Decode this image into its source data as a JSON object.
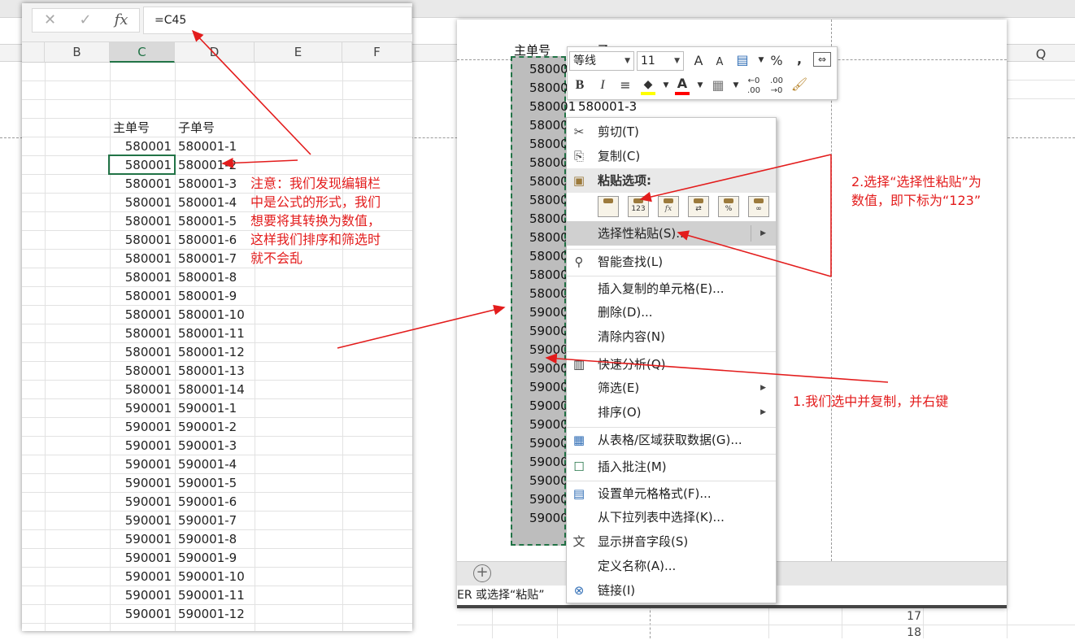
{
  "left": {
    "formula_bar": {
      "cancel_icon": "✕",
      "enter_icon": "✓",
      "fx_label": "fx",
      "formula": "=C45"
    },
    "columns": [
      "B",
      "C",
      "D",
      "E",
      "F"
    ],
    "header_row": {
      "main": "主单号",
      "sub": "子单号"
    },
    "rows": [
      {
        "main": "580001",
        "sub": "580001-1"
      },
      {
        "main": "580001",
        "sub": "580001-2"
      },
      {
        "main": "580001",
        "sub": "580001-3"
      },
      {
        "main": "580001",
        "sub": "580001-4"
      },
      {
        "main": "580001",
        "sub": "580001-5"
      },
      {
        "main": "580001",
        "sub": "580001-6"
      },
      {
        "main": "580001",
        "sub": "580001-7"
      },
      {
        "main": "580001",
        "sub": "580001-8"
      },
      {
        "main": "580001",
        "sub": "580001-9"
      },
      {
        "main": "580001",
        "sub": "580001-10"
      },
      {
        "main": "580001",
        "sub": "580001-11"
      },
      {
        "main": "580001",
        "sub": "580001-12"
      },
      {
        "main": "580001",
        "sub": "580001-13"
      },
      {
        "main": "580001",
        "sub": "580001-14"
      },
      {
        "main": "590001",
        "sub": "590001-1"
      },
      {
        "main": "590001",
        "sub": "590001-2"
      },
      {
        "main": "590001",
        "sub": "590001-3"
      },
      {
        "main": "590001",
        "sub": "590001-4"
      },
      {
        "main": "590001",
        "sub": "590001-5"
      },
      {
        "main": "590001",
        "sub": "590001-6"
      },
      {
        "main": "590001",
        "sub": "590001-7"
      },
      {
        "main": "590001",
        "sub": "590001-8"
      },
      {
        "main": "590001",
        "sub": "590001-9"
      },
      {
        "main": "590001",
        "sub": "590001-10"
      },
      {
        "main": "590001",
        "sub": "590001-11"
      },
      {
        "main": "590001",
        "sub": "590001-12"
      }
    ]
  },
  "annotations": {
    "note_lines": [
      "注意：我们发现编辑栏",
      "中是公式的形式，我们",
      "想要将其转换为数值，",
      "这样我们排序和筛选时",
      "就不会乱"
    ],
    "step2_lines": [
      "2.选择“选择性粘贴”为",
      "数值，即下标为“123”"
    ],
    "step1": "1.我们选中并复制，并右键"
  },
  "right": {
    "header_main": "主单号",
    "header_partial": "子",
    "col_q": "Q",
    "column_values": [
      "58000",
      "58000",
      "580001",
      "58000",
      "58000",
      "58000",
      "58000",
      "58000",
      "58000",
      "58000",
      "58000",
      "58000",
      "58000",
      "59000",
      "59000",
      "59000",
      "59000",
      "59000",
      "59000",
      "59000",
      "59000",
      "59000",
      "59000",
      "59000",
      "59000"
    ],
    "row3_sub": "580001-3",
    "add_sheet_icon": "+",
    "status_text": "ER 或选择“粘贴”",
    "row_numbers": [
      "17",
      "18"
    ]
  },
  "mini_toolbar": {
    "font": "等线",
    "size": "11",
    "grow": "A",
    "shrink": "A",
    "currency": "💰",
    "percent": "%",
    "comma": ",",
    "wrap": "⇔",
    "bold": "B",
    "italic": "I",
    "align": "≡",
    "fill_color": "#ffff00",
    "font_color_letter": "A",
    "font_color": "#ff0000",
    "borders": "▦",
    "inc_dec": ".00",
    "dec_dec": ".00",
    "painter": "🖌"
  },
  "menu": {
    "items": [
      {
        "label": "剪切(T)",
        "icon": "✂"
      },
      {
        "label": "复制(C)",
        "icon": "⎘"
      },
      {
        "label": "粘贴选项:",
        "icon": "📋"
      },
      {
        "label": "选择性粘贴(S)...",
        "icon": ""
      },
      {
        "label": "智能查找(L)",
        "icon": "🔍"
      },
      {
        "label": "插入复制的单元格(E)...",
        "icon": ""
      },
      {
        "label": "删除(D)...",
        "icon": ""
      },
      {
        "label": "清除内容(N)",
        "icon": ""
      },
      {
        "label": "快速分析(Q)",
        "icon": "⚡"
      },
      {
        "label": "筛选(E)",
        "icon": ""
      },
      {
        "label": "排序(O)",
        "icon": ""
      },
      {
        "label": "从表格/区域获取数据(G)...",
        "icon": "▦"
      },
      {
        "label": "插入批注(M)",
        "icon": "💬"
      },
      {
        "label": "设置单元格格式(F)...",
        "icon": "▤"
      },
      {
        "label": "从下拉列表中选择(K)...",
        "icon": ""
      },
      {
        "label": "显示拼音字段(S)",
        "icon": "文"
      },
      {
        "label": "定义名称(A)...",
        "icon": ""
      },
      {
        "label": "链接(I)",
        "icon": "🔗"
      }
    ],
    "paste_options": [
      "粘贴",
      "123",
      "fx",
      "⇄",
      "%",
      "∞"
    ],
    "submenu_arrow": "▶"
  }
}
